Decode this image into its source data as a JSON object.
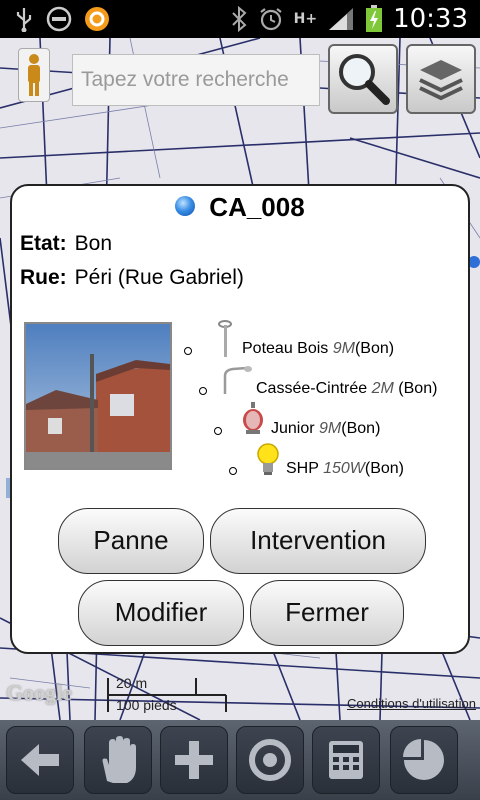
{
  "status_bar": {
    "time": "10:33",
    "network": "H+"
  },
  "search": {
    "placeholder": "Tapez votre recherche"
  },
  "popup": {
    "title": "CA_008",
    "fields": [
      {
        "label": "Etat:",
        "value": "Bon"
      },
      {
        "label": "Rue:",
        "value": "Péri (Rue Gabriel)"
      }
    ],
    "components": [
      {
        "name": "Poteau Bois",
        "size": "9M",
        "state": "(Bon)",
        "icon": "pole-icon"
      },
      {
        "name": "Cassée-Cintrée",
        "size": "2M",
        "state": "(Bon)",
        "icon": "bracket-icon"
      },
      {
        "name": "Junior",
        "size": "9M",
        "state": "(Bon)",
        "icon": "lantern-icon"
      },
      {
        "name": "SHP",
        "size": "150W",
        "state": "(Bon)",
        "icon": "bulb-icon"
      }
    ],
    "buttons": {
      "panne": "Panne",
      "intervention": "Intervention",
      "modifier": "Modifier",
      "fermer": "Fermer"
    }
  },
  "map": {
    "provider": "Google",
    "scale_metric": "20 m",
    "scale_imperial": "100 pieds",
    "conditions": "Conditions d'utilisation"
  },
  "bottom_bar": [
    "back-arrow-icon",
    "hand-icon",
    "plus-icon",
    "target-icon",
    "calculator-icon",
    "pie-chart-icon"
  ]
}
